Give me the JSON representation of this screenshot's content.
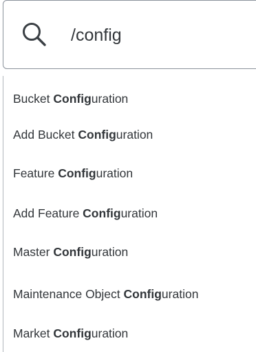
{
  "search": {
    "value": "/config",
    "icon": "search-icon"
  },
  "results": [
    {
      "pre": "Bucket ",
      "match": "Config",
      "post": "uration"
    },
    {
      "pre": "Add Bucket ",
      "match": "Config",
      "post": "uration"
    },
    {
      "pre": "Feature ",
      "match": "Config",
      "post": "uration"
    },
    {
      "pre": "Add Feature ",
      "match": "Config",
      "post": "uration"
    },
    {
      "pre": "Master ",
      "match": "Config",
      "post": "uration"
    },
    {
      "pre": "Maintenance Object ",
      "match": "Config",
      "post": "uration"
    },
    {
      "pre": "Market ",
      "match": "Config",
      "post": "uration"
    }
  ],
  "colors": {
    "text": "#32363a",
    "border": "#89919a"
  }
}
